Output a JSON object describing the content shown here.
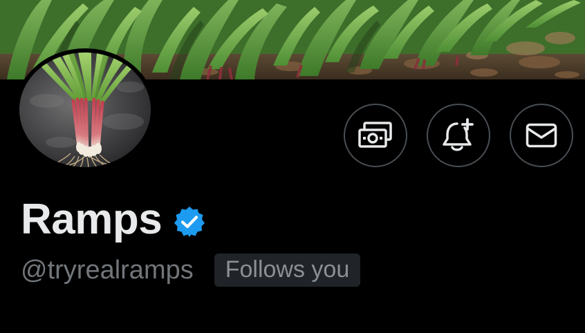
{
  "banner": {
    "image_alt": "Wild ramp plants growing on forest floor"
  },
  "avatar": {
    "image_alt": "Bundle of harvested ramps"
  },
  "actions": {
    "tip_icon": "money-icon",
    "notify_icon": "bell-plus-icon",
    "message_icon": "envelope-icon"
  },
  "profile": {
    "display_name": "Ramps",
    "verified_icon": "verified-badge-icon",
    "handle": "@tryrealramps",
    "follows_you": "Follows you"
  },
  "colors": {
    "background": "#000000",
    "name_text": "#e7e9ea",
    "handle_text": "#71767b",
    "verified_blue": "#1d9bf0",
    "button_border": "#4a4f54",
    "follows_badge_bg": "#202327"
  }
}
